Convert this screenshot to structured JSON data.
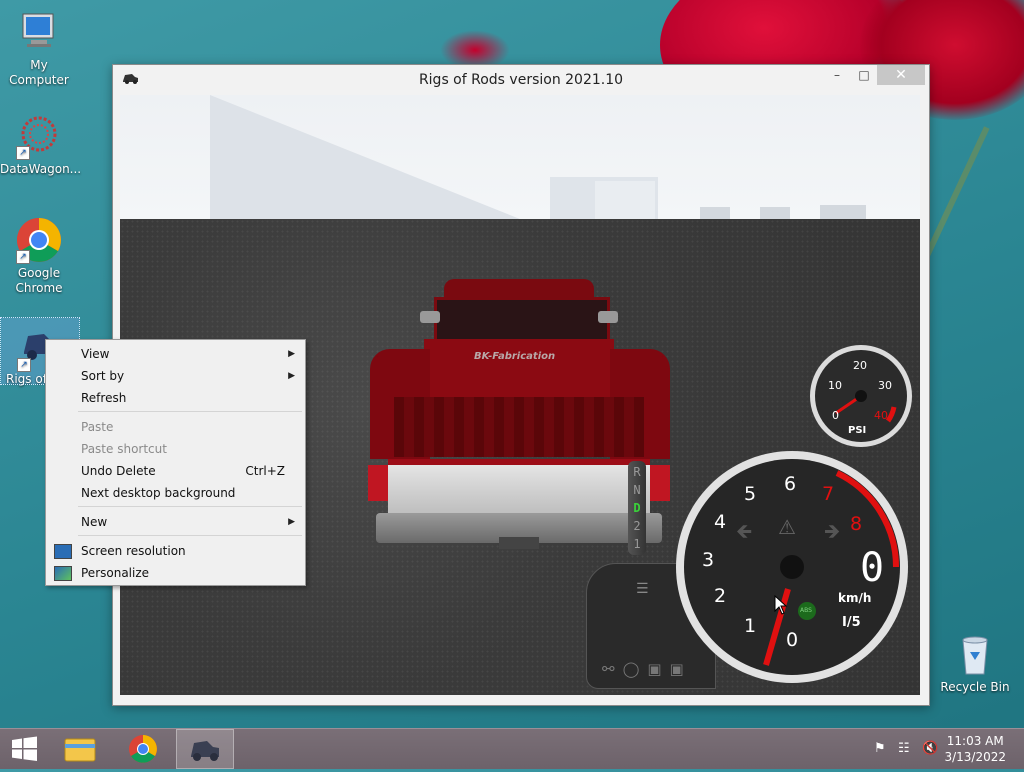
{
  "desktop": {
    "icons": [
      {
        "label": "My Computer"
      },
      {
        "label": "DataWagon..."
      },
      {
        "label": "Google Chrome"
      },
      {
        "label": "Rigs of"
      },
      {
        "label": "Recycle Bin"
      }
    ]
  },
  "window": {
    "title": "Rigs of Rods version 2021.10",
    "min_glyph": "–",
    "max_glyph": "□",
    "close_glyph": "✕"
  },
  "scene": {
    "tailgate_text": "BK-Fabrication",
    "gears": [
      "R",
      "N",
      "D",
      "2",
      "1"
    ],
    "active_gear": "D",
    "pressure_gauge": {
      "unit": "PSI",
      "ticks": [
        "0",
        "10",
        "20",
        "30",
        "40"
      ]
    },
    "rpm_gauge": {
      "ticks": [
        "0",
        "1",
        "2",
        "3",
        "4",
        "5",
        "6",
        "7",
        "8"
      ]
    },
    "speed": {
      "value": "0",
      "unit": "km/h",
      "gear_ratio": "I/5"
    },
    "abs_label": "ABS"
  },
  "context_menu": {
    "items": [
      {
        "label": "View",
        "has_submenu": true
      },
      {
        "label": "Sort by",
        "has_submenu": true
      },
      {
        "label": "Refresh"
      },
      {
        "label": "Paste",
        "disabled": true
      },
      {
        "label": "Paste shortcut",
        "disabled": true
      },
      {
        "label": "Undo Delete",
        "shortcut": "Ctrl+Z"
      },
      {
        "label": "Next desktop background"
      },
      {
        "label": "New",
        "has_submenu": true
      },
      {
        "label": "Screen resolution",
        "icon": "monitor-icon"
      },
      {
        "label": "Personalize",
        "icon": "personalize-icon"
      }
    ],
    "submenu_arrow": "▶"
  },
  "taskbar": {
    "time": "11:03 AM",
    "date": "3/13/2022"
  },
  "colors": {
    "truck_red": "#8b0a12",
    "gear_active": "#3ad13a",
    "needle": "#e01010"
  }
}
